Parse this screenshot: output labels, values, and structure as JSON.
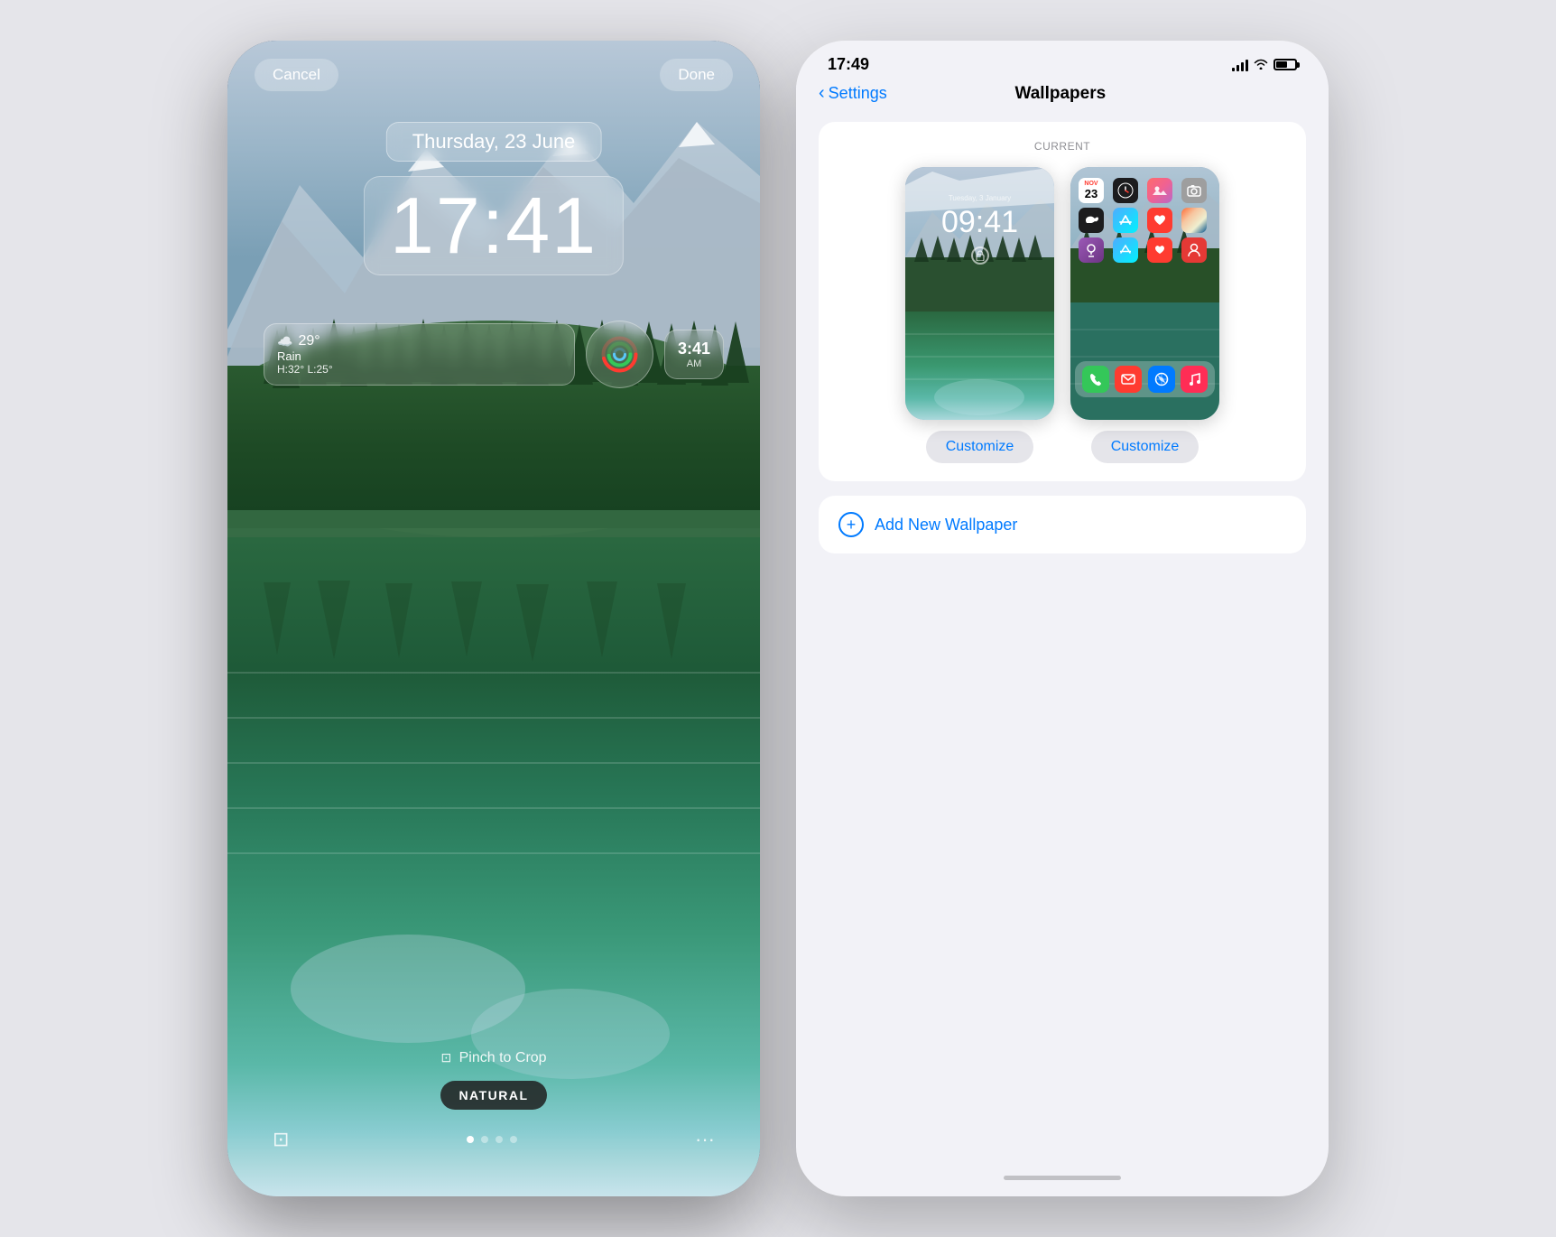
{
  "left_phone": {
    "cancel_label": "Cancel",
    "done_label": "Done",
    "date": "Thursday, 23 June",
    "time": "17:41",
    "weather": {
      "icon": "☁️",
      "temp": "29°",
      "description": "Rain",
      "range": "H:32° L:25°"
    },
    "alarm": {
      "time": "3:41",
      "unit": "AM"
    },
    "pinch_label": "Pinch to Crop",
    "filter_label": "NATURAL",
    "dots": [
      "active",
      "inactive",
      "inactive",
      "inactive"
    ]
  },
  "right_phone": {
    "status_time": "17:49",
    "back_label": "Settings",
    "title": "Wallpapers",
    "section_label": "CURRENT",
    "lock_screen": {
      "date_mini": "Tuesday, 3 January",
      "time_mini": "09:41"
    },
    "customize_label": "Customize",
    "add_wallpaper_label": "Add New Wallpaper"
  }
}
